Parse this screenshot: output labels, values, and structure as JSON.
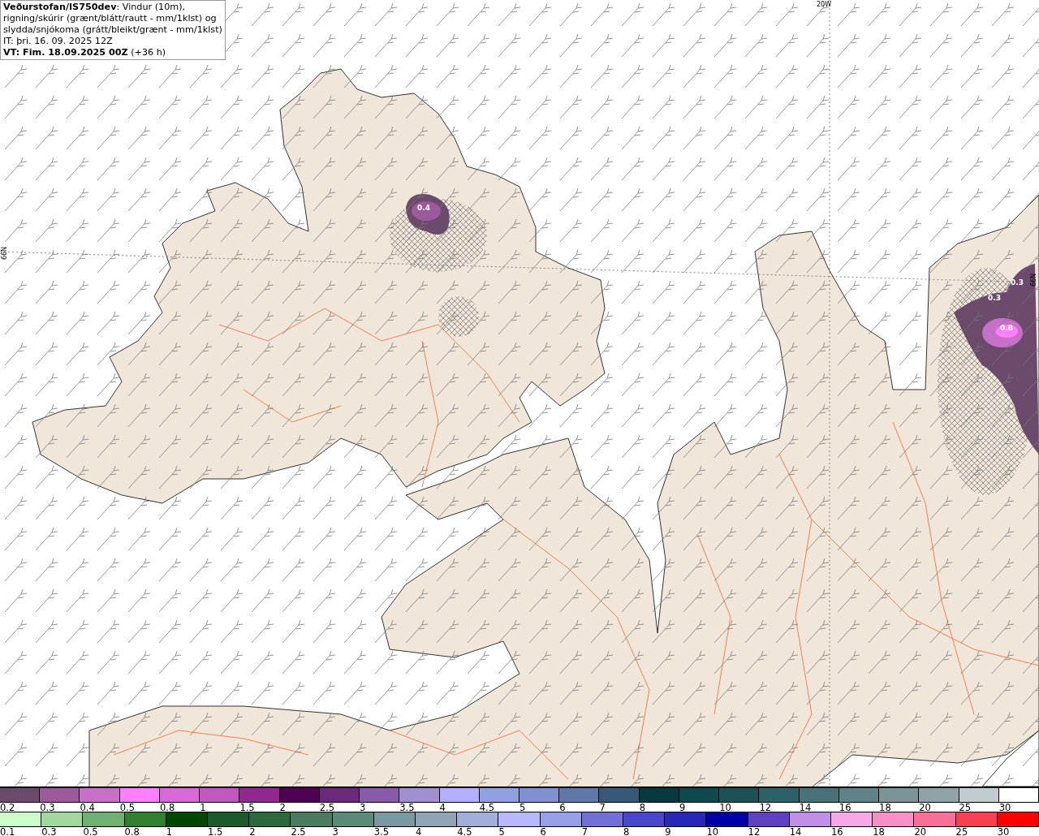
{
  "title_lines": [
    "**Veðurstofan/IS750dev**: Vindur (10m),",
    "rigning/skúrir (grænt/blátt/rautt - mm/1klst) og",
    "slydda/snjókoma (grátt/bleikt/grænt - mm/1klst)",
    "IT: þri. 16. 09. 2025 12Z",
    "**VT: Fim. 18.09.2025 00Z** (+36 h)"
  ],
  "map": {
    "grid_labels": [
      {
        "text": "20W",
        "kind": "top"
      },
      {
        "text": "66N",
        "kind": "left"
      },
      {
        "text": "66N",
        "kind": "right"
      }
    ],
    "precip_labels": [
      "0.4",
      "0.3",
      "0.3",
      "0.8"
    ]
  },
  "legend": [
    {
      "items": [
        {
          "color": "#6b4a6b",
          "label": "0.2"
        },
        {
          "color": "#9c5a9c",
          "label": "0.3"
        },
        {
          "color": "#c870c8",
          "label": "0.4"
        },
        {
          "color": "#ff80ff",
          "label": "0.5"
        },
        {
          "color": "#d868d8",
          "label": "0.8"
        },
        {
          "color": "#c058c0",
          "label": "1"
        },
        {
          "color": "#902890",
          "label": "1.5"
        },
        {
          "color": "#500050",
          "label": "2"
        },
        {
          "color": "#6a2a7a",
          "label": "2.5"
        },
        {
          "color": "#8a5aaa",
          "label": "3"
        },
        {
          "color": "#a090d0",
          "label": "3.5"
        },
        {
          "color": "#b0b0ff",
          "label": "4"
        },
        {
          "color": "#90a0e0",
          "label": "4.5"
        },
        {
          "color": "#8090d0",
          "label": "5"
        },
        {
          "color": "#6078a8",
          "label": "6"
        },
        {
          "color": "#385878",
          "label": "7"
        },
        {
          "color": "#083840",
          "label": "8"
        },
        {
          "color": "#104850",
          "label": "9"
        },
        {
          "color": "#1e5058",
          "label": "10"
        },
        {
          "color": "#2e6068",
          "label": "12"
        },
        {
          "color": "#4a7078",
          "label": "14"
        },
        {
          "color": "#5e8288",
          "label": "16"
        },
        {
          "color": "#7a9498",
          "label": "18"
        },
        {
          "color": "#90a4a8",
          "label": "20"
        },
        {
          "color": "#c0ccd0",
          "label": "25"
        },
        {
          "color": "#ffffff",
          "label": "30"
        }
      ]
    },
    {
      "items": [
        {
          "color": "#ccffcc",
          "label": "0.1"
        },
        {
          "color": "#a0d8a0",
          "label": "0.3"
        },
        {
          "color": "#70b070",
          "label": "0.5"
        },
        {
          "color": "#308030",
          "label": "0.8"
        },
        {
          "color": "#004800",
          "label": "1"
        },
        {
          "color": "#1a5a2a",
          "label": "1.5"
        },
        {
          "color": "#2a6a3a",
          "label": "2"
        },
        {
          "color": "#4a7a60",
          "label": "2.5"
        },
        {
          "color": "#5a8a78",
          "label": "3"
        },
        {
          "color": "#7a98a0",
          "label": "3.5"
        },
        {
          "color": "#90a4b8",
          "label": "4"
        },
        {
          "color": "#a0b0d8",
          "label": "4.5"
        },
        {
          "color": "#b8b8ff",
          "label": "5"
        },
        {
          "color": "#98a0e8",
          "label": "6"
        },
        {
          "color": "#7070d8",
          "label": "7"
        },
        {
          "color": "#4848c8",
          "label": "8"
        },
        {
          "color": "#2828b8",
          "label": "9"
        },
        {
          "color": "#0000a8",
          "label": "10"
        },
        {
          "color": "#6040c0",
          "label": "12"
        },
        {
          "color": "#c090e8",
          "label": "14"
        },
        {
          "color": "#f8a8e8",
          "label": "16"
        },
        {
          "color": "#f890c8",
          "label": "18"
        },
        {
          "color": "#f87098",
          "label": "20"
        },
        {
          "color": "#f84050",
          "label": "25"
        },
        {
          "color": "#ff0000",
          "label": "30"
        }
      ]
    }
  ]
}
